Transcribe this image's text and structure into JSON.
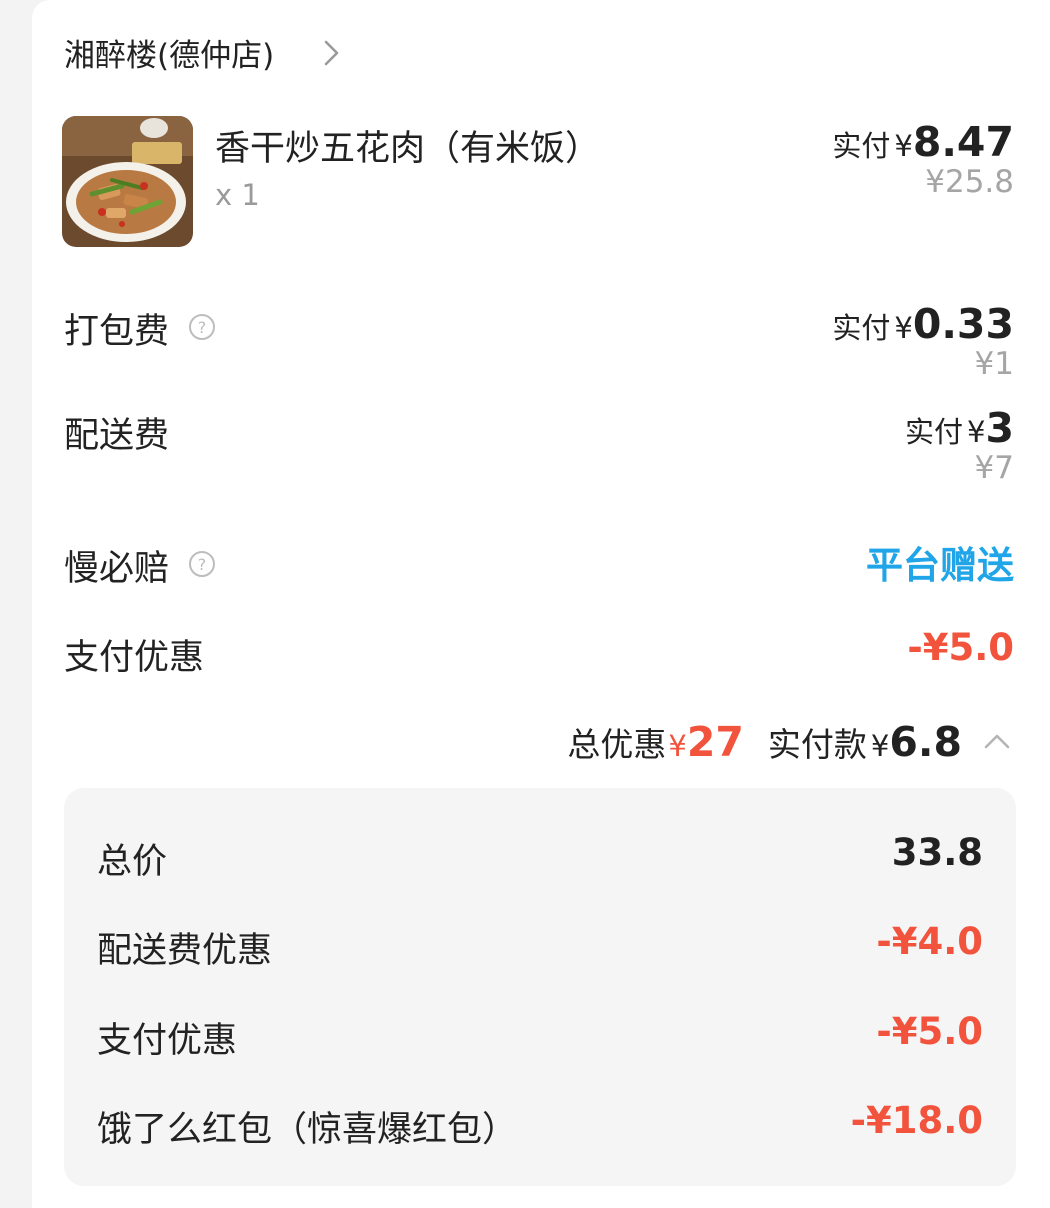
{
  "store": {
    "name": "湘醉楼(德仲店)",
    "chevron_icon": "chevron-right-icon"
  },
  "item": {
    "name": "香干炒五花肉（有米饭）",
    "qty": "x 1",
    "paid_label": "实付",
    "currency": "¥",
    "paid_amount": "8.47",
    "original_price": "¥25.8"
  },
  "fees": [
    {
      "label": "打包费",
      "has_help_icon": true,
      "paid_label": "实付",
      "currency": "¥",
      "paid_amount": "0.33",
      "original_price": "¥1"
    },
    {
      "label": "配送费",
      "has_help_icon": false,
      "paid_label": "实付",
      "currency": "¥",
      "paid_amount": "3",
      "original_price": "¥7"
    }
  ],
  "slow_compensation": {
    "label": "慢必赔",
    "value": "平台赠送"
  },
  "payment_discount": {
    "label": "支付优惠",
    "value": "-¥5.0"
  },
  "summary": {
    "total_discount_label": "总优惠",
    "currency": "¥",
    "total_discount": "27",
    "paid_total_label": "实付款",
    "paid_total": "6.8",
    "toggle_icon": "chevron-up-icon"
  },
  "breakdown": [
    {
      "label": "总价",
      "value": "33.8",
      "tone": "dark"
    },
    {
      "label": "配送费优惠",
      "value": "-¥4.0",
      "tone": "red"
    },
    {
      "label": "支付优惠",
      "value": "-¥5.0",
      "tone": "red"
    },
    {
      "label": "饿了么红包（惊喜爆红包）",
      "value": "-¥18.0",
      "tone": "red"
    }
  ],
  "colors": {
    "accent_blue": "#1fa5e8",
    "discount_red": "#f2533c",
    "muted_gray": "#a5a5a5"
  }
}
